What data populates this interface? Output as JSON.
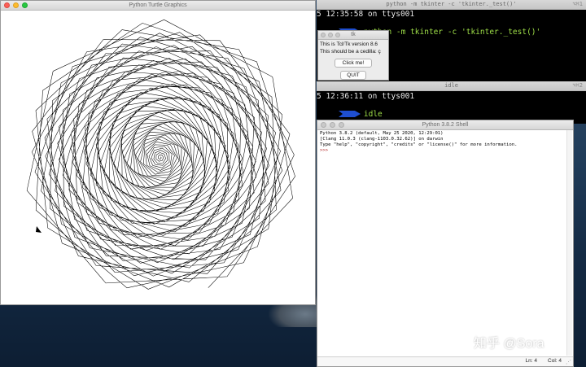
{
  "desktop": {
    "watermark": "知乎 @Sora"
  },
  "turtle_window": {
    "title": "Python Turtle Graphics",
    "drawing": {
      "shape": "polygon-spiral",
      "sides": 7,
      "turns": 140,
      "stroke": "#000000",
      "background": "#ffffff"
    }
  },
  "terminal1": {
    "title": "python -m tkinter -c 'tkinter._test()'",
    "shortcut": "⌥⌘1",
    "line1": "5 12:35:58 on ttys001",
    "command": "python -m tkinter -c 'tkinter._test()'"
  },
  "tk_test": {
    "title": "tk",
    "version_text": "This is Tcl/Tk version 8.6",
    "cedilla_text": "This should be a cedilla: ç",
    "click_label": "Click me!",
    "quit_label": "QUIT"
  },
  "terminal2": {
    "title": "idle",
    "shortcut": "⌥⌘2",
    "line1": "5 12:36:11 on ttys001",
    "command": "idle"
  },
  "idle_shell": {
    "title": "Python 3.8.2 Shell",
    "lines": [
      "Python 3.8.2 (default, May 25 2020, 12:29:01)",
      "[Clang 11.0.3 (clang-1103.0.32.62)] on darwin",
      "Type \"help\", \"copyright\", \"credits\" or \"license()\" for more information."
    ],
    "prompt": ">>>",
    "status_line": "Ln: 4",
    "status_col": "Col: 4"
  },
  "colors": {
    "prompt_arrow": "#1f4fd1",
    "command_green": "#9fdf48",
    "idle_prompt": "#b22222"
  }
}
